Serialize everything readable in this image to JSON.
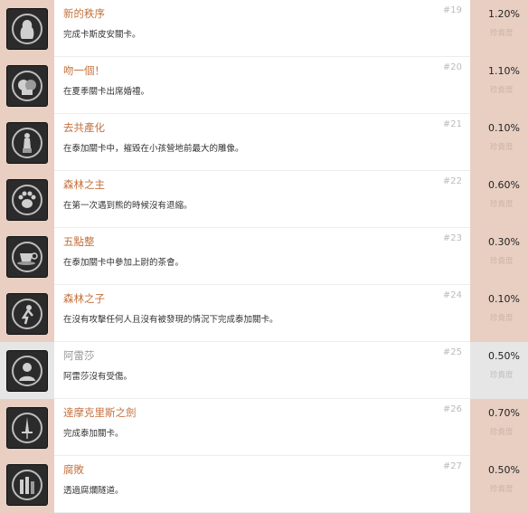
{
  "achievements": [
    {
      "icon": "silhouette-icon",
      "title": "新的秩序",
      "desc": "完成卡斯皮安關卡。",
      "num": "#19",
      "pct": "1.20%",
      "rarity": "珍貴度",
      "unlocked": false
    },
    {
      "icon": "kiss-icon",
      "title": "吻一個！",
      "desc": "在夏季關卡出席婚禮。",
      "num": "#20",
      "pct": "1.10%",
      "rarity": "珍貴度",
      "unlocked": false
    },
    {
      "icon": "statue-icon",
      "title": "去共產化",
      "desc": "在泰加關卡中，摧毀在小孩營地前最大的雕像。",
      "num": "#21",
      "pct": "0.10%",
      "rarity": "珍貴度",
      "unlocked": false
    },
    {
      "icon": "paw-icon",
      "title": "森林之主",
      "desc": "在第一次遇到熊的時候沒有退縮。",
      "num": "#22",
      "pct": "0.60%",
      "rarity": "珍貴度",
      "unlocked": false
    },
    {
      "icon": "teacup-icon",
      "title": "五點整",
      "desc": "在泰加關卡中參加上尉的茶會。",
      "num": "#23",
      "pct": "0.30%",
      "rarity": "珍貴度",
      "unlocked": false
    },
    {
      "icon": "child-icon",
      "title": "森林之子",
      "desc": "在沒有攻擊任何人且沒有被發現的情況下完成泰加關卡。",
      "num": "#24",
      "pct": "0.10%",
      "rarity": "珍貴度",
      "unlocked": false
    },
    {
      "icon": "portrait-icon",
      "title": "阿雷莎",
      "desc": "阿雷莎沒有受傷。",
      "num": "#25",
      "pct": "0.50%",
      "rarity": "珍貴度",
      "unlocked": true
    },
    {
      "icon": "sword-icon",
      "title": "達摩克里斯之劍",
      "desc": "完成泰加關卡。",
      "num": "#26",
      "pct": "0.70%",
      "rarity": "珍貴度",
      "unlocked": false
    },
    {
      "icon": "ruin-icon",
      "title": "腐敗",
      "desc": "透過腐爛隧道。",
      "num": "#27",
      "pct": "0.50%",
      "rarity": "珍貴度",
      "unlocked": false
    }
  ]
}
